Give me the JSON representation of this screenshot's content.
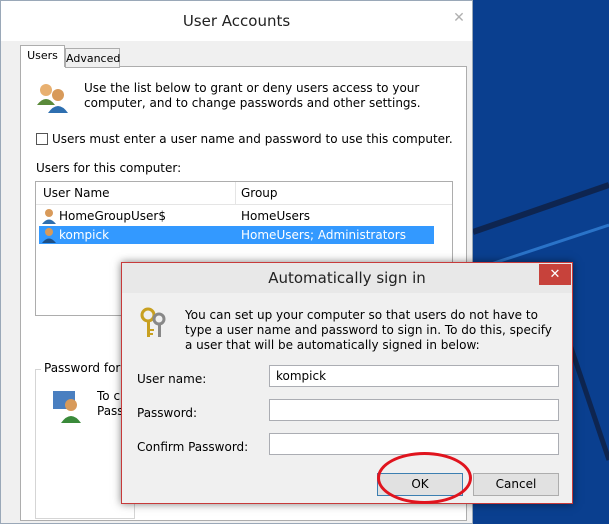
{
  "colors": {
    "desktop": "#0a3f8f",
    "selection": "#3399ff",
    "dialog_close": "#c7423b",
    "highlight_circle": "#e0141e"
  },
  "user_accounts": {
    "title": "User Accounts",
    "close_glyph": "✕",
    "tabs": [
      {
        "label": "Users",
        "active": true
      },
      {
        "label": "Advanced",
        "active": false
      }
    ],
    "intro_text": "Use the list below to grant or deny users access to your computer, and to change passwords and other settings.",
    "checkbox_label": "Users must enter a user name and password to use this computer.",
    "checkbox_checked": false,
    "users_label": "Users for this computer:",
    "columns": [
      "User Name",
      "Group"
    ],
    "users": [
      {
        "name": "HomeGroupUser$",
        "group": "HomeUsers",
        "selected": false
      },
      {
        "name": "kompick",
        "group": "HomeUsers; Administrators",
        "selected": true
      }
    ],
    "password_group_legend": "Password for kompick",
    "password_text_partial": "To change\nPassword"
  },
  "auto_signin": {
    "title": "Automatically sign in",
    "close_glyph": "✕",
    "description": "You can set up your computer so that users do not have to type a user name and password to sign in. To do this, specify a user that will be automatically signed in below:",
    "fields": {
      "username_label": "User name:",
      "username_value": "kompick",
      "password_label": "Password:",
      "password_value": "",
      "confirm_label": "Confirm Password:",
      "confirm_value": ""
    },
    "ok_label": "OK",
    "cancel_label": "Cancel"
  }
}
